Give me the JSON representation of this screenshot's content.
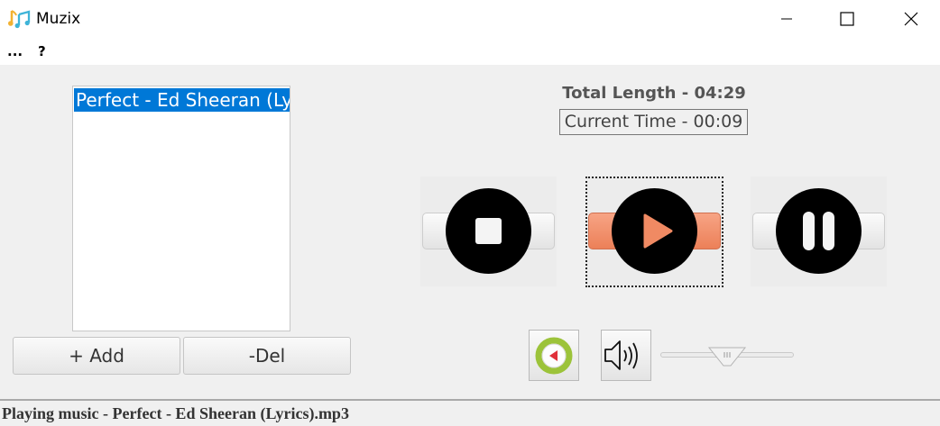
{
  "window": {
    "title": "Muzix",
    "app_icon": "music-note-icon",
    "controls": [
      "minimize-icon",
      "maximize-icon",
      "close-icon"
    ]
  },
  "menu": {
    "items": [
      "...",
      "?"
    ]
  },
  "playlist": {
    "items": [
      {
        "label": "Perfect - Ed Sheeran (Lyrics)",
        "selected": true
      }
    ]
  },
  "buttons": {
    "add_label": "+ Add",
    "del_label": "-Del"
  },
  "time": {
    "total_length": "Total Length - 04:29",
    "current_time": "Current Time - 00:09"
  },
  "controls": {
    "stop_icon": "stop-icon",
    "play_icon": "play-icon",
    "pause_icon": "pause-icon",
    "prev_icon": "previous-track-icon",
    "volume_icon": "speaker-icon"
  },
  "volume": {
    "level": 0.5
  },
  "colors": {
    "selection": "#0078d7",
    "play_accent": "#f08a63",
    "prev_ring": "#9cc33a"
  },
  "status": {
    "text": "Playing music - Perfect - Ed Sheeran (Lyrics).mp3"
  }
}
